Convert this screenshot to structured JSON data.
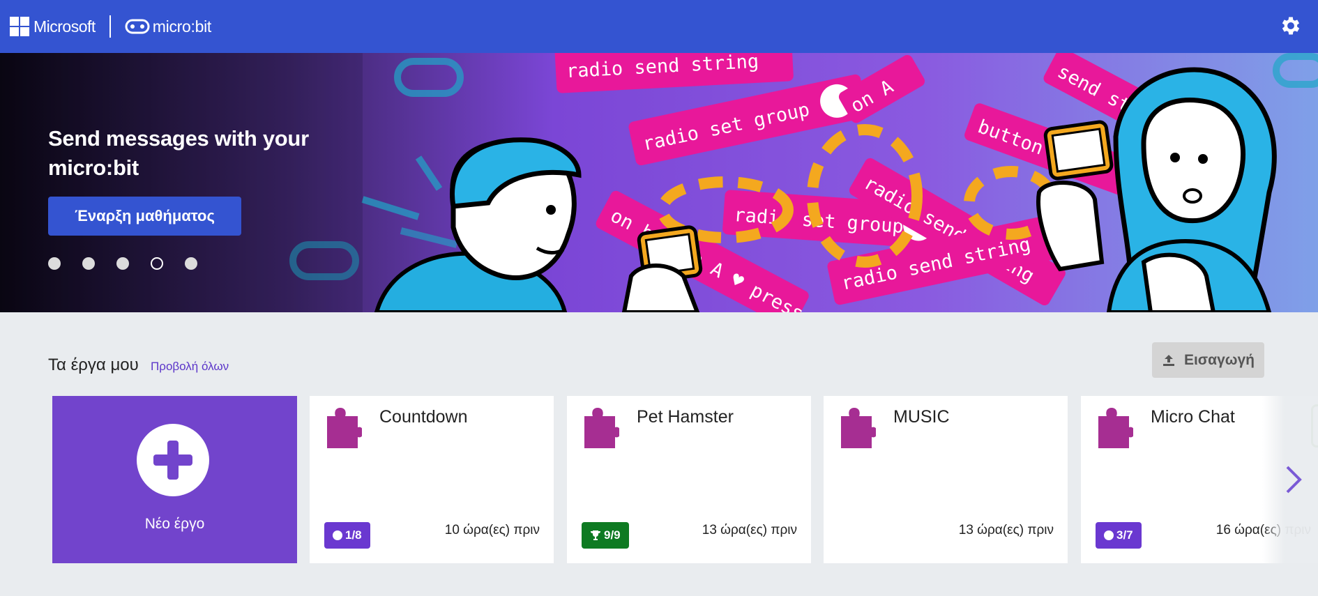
{
  "header": {
    "microsoft_label": "Microsoft",
    "microbit_label": "micro:bit",
    "settings_icon": "gear-icon",
    "color": "#3454d1"
  },
  "hero": {
    "title": "Send messages with your micro:bit",
    "start_button": "Έναρξη μαθήματος",
    "slides_count": 5,
    "active_slide": 4,
    "art_blocks": [
      "radio send string",
      "radio set group",
      "radio set group",
      "radio send string",
      "radio send string",
      "on button A pressed",
      "on A",
      "button A",
      "send stri"
    ]
  },
  "projects": {
    "title": "Τα έργα μου",
    "view_all": "Προβολή όλων",
    "import_label": "Εισαγωγή",
    "new_project_label": "Νέο έργο",
    "items": [
      {
        "name": "Countdown",
        "badge": "1/8",
        "badge_type": "progress",
        "badge_color": "#6a38d0",
        "time": "10 ώρα(ες) πριν"
      },
      {
        "name": "Pet Hamster",
        "badge": "9/9",
        "badge_type": "trophy",
        "badge_color": "#0e7a22",
        "time": "13 ώρα(ες) πριν"
      },
      {
        "name": "MUSIC",
        "badge": "",
        "badge_type": "none",
        "time": "13 ώρα(ες) πριν"
      },
      {
        "name": "Micro Chat",
        "badge": "3/7",
        "badge_type": "progress",
        "badge_color": "#6a38d0",
        "time": "16 ώρα(ες) πριν"
      }
    ]
  }
}
